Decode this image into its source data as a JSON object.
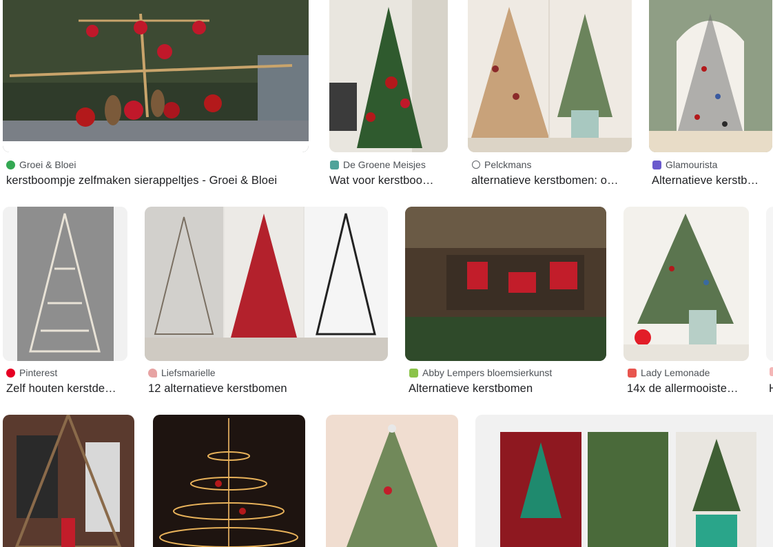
{
  "results": [
    {
      "source": "Groei & Bloei",
      "title": "kerstboompje zelfmaken sierappeltjes - Groei & Bloei",
      "favicon": "groei-bloei-icon",
      "favicon_color": "#34a853"
    },
    {
      "source": "De Groene Meisjes",
      "title": "Wat voor kerstboo…",
      "favicon": "groene-meisjes-icon",
      "favicon_color": "#4fa39a"
    },
    {
      "source": "Pelckmans",
      "title": "alternatieve kerstbomen: o…",
      "favicon": "globe-icon",
      "favicon_color": "#5f6368"
    },
    {
      "source": "Glamourista",
      "title": "Alternatieve kerstb…",
      "favicon": "glamourista-icon",
      "favicon_color": "#6a5acd"
    },
    {
      "source": "Pinterest",
      "title": "Zelf houten kerstde…",
      "favicon": "pinterest-icon",
      "favicon_color": "#e60023"
    },
    {
      "source": "Liefsmarielle",
      "title": "12 alternatieve kerstbomen",
      "favicon": "heart-icon",
      "favicon_color": "#e7a3a3"
    },
    {
      "source": "Abby Lempers bloemsierkunst",
      "title": "Alternatieve kerstbomen",
      "favicon": "abby-lempers-icon",
      "favicon_color": "#8bc34a"
    },
    {
      "source": "Lady Lemonade",
      "title": "14x de allermooiste…",
      "favicon": "lady-lemonade-icon",
      "favicon_color": "#e8554e"
    },
    {
      "source": "",
      "title": "H",
      "favicon": "partial-icon",
      "favicon_color": "#f4b6b6"
    }
  ]
}
